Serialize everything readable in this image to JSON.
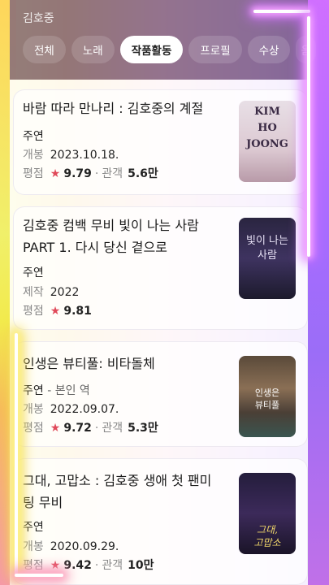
{
  "query_title": "김호중",
  "tabs": [
    {
      "label": "전체"
    },
    {
      "label": "노래"
    },
    {
      "label": "작품활동"
    },
    {
      "label": "프로필"
    },
    {
      "label": "수상"
    },
    {
      "label": "음"
    }
  ],
  "active_tab": "작품활동",
  "works": [
    {
      "title": "바람 따라 만나리 : 김호중의 계절",
      "role": "주연",
      "date_label": "개봉",
      "date": "2023.10.18.",
      "rating_label": "평점",
      "rating": "9.79",
      "audience_label": "관객",
      "audience": "5.6만",
      "poster_text": "KIM HO JOONG"
    },
    {
      "title": "김호중 컴백 무비 빛이 나는 사람 PART 1. 다시 당신 곁으로",
      "role": "주연",
      "date_label": "제작",
      "date": "2022",
      "rating_label": "평점",
      "rating": "9.81",
      "poster_text": "빛이 나는 사람"
    },
    {
      "title": "인생은 뷰티풀: 비타돌체",
      "role": "주연",
      "role_detail": "본인 역",
      "date_label": "개봉",
      "date": "2022.09.07.",
      "rating_label": "평점",
      "rating": "9.72",
      "audience_label": "관객",
      "audience": "5.3만",
      "poster_text": "인생은 뷰티풀"
    },
    {
      "title": "그대, 고맙소 : 김호중 생애 첫 팬미팅 무비",
      "role": "주연",
      "date_label": "개봉",
      "date": "2020.09.29.",
      "rating_label": "평점",
      "rating": "9.42",
      "audience_label": "관객",
      "audience": "10만",
      "poster_text": "그대, 고맙소"
    }
  ],
  "icons": {
    "rating": "star-icon"
  },
  "colors": {
    "star": "#e04a5a",
    "active_tab_bg": "#ffffff"
  }
}
